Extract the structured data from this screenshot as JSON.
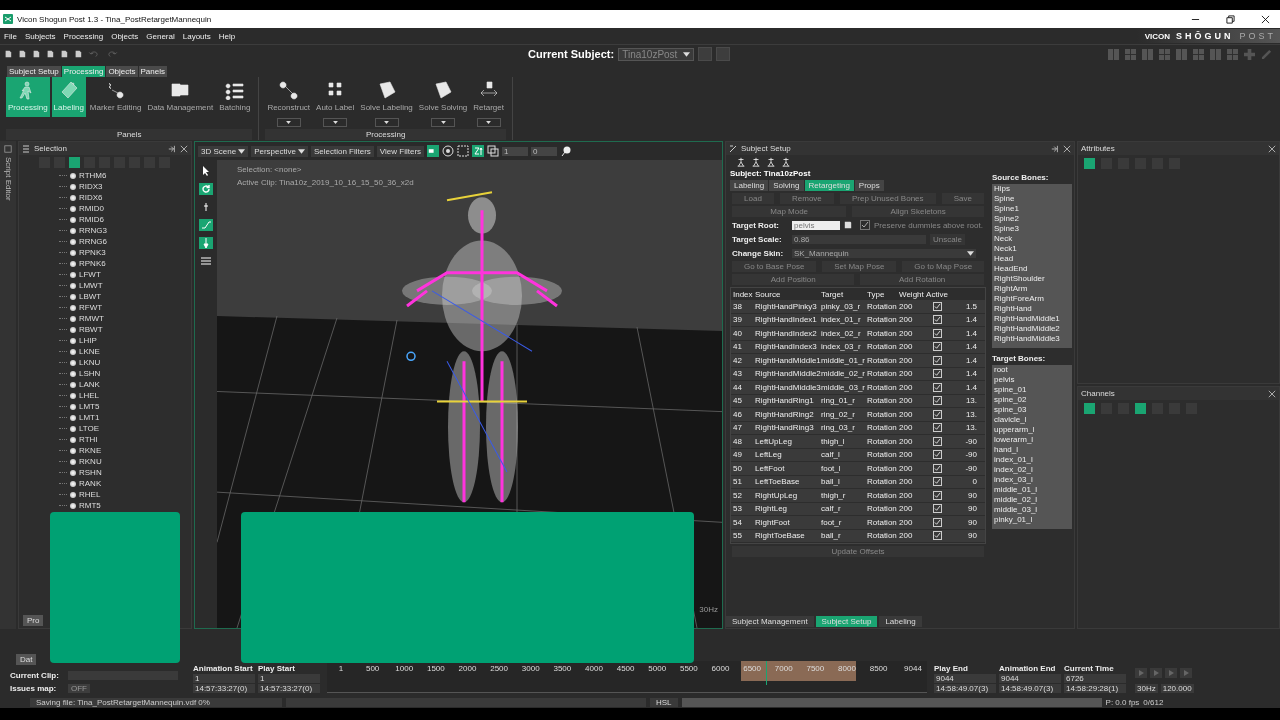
{
  "window": {
    "title": "Vicon Shogun Post 1.3  - Tina_PostRetargetMannequin"
  },
  "menu": [
    "File",
    "Subjects",
    "Processing",
    "Objects",
    "General",
    "Layouts",
    "Help"
  ],
  "brand": {
    "maker": "VICON",
    "product": "SHŌGUN",
    "edition": "POST"
  },
  "toolbar": {
    "current_subject_label": "Current Subject:",
    "current_subject": "Tina10zPost"
  },
  "ribbon": {
    "tabs": [
      {
        "label": "Subject Setup",
        "selected": false
      },
      {
        "label": "Processing",
        "selected": true
      },
      {
        "label": "Objects",
        "selected": false
      },
      {
        "label": "Panels",
        "selected": false
      }
    ],
    "groups": [
      {
        "label": "Panels",
        "buttons": [
          {
            "label": "Processing",
            "selected": true,
            "dropdown": false
          },
          {
            "label": "Labeling",
            "selected": true,
            "dropdown": false
          },
          {
            "label": "Marker Editing",
            "selected": false,
            "dropdown": false
          },
          {
            "label": "Data Management",
            "selected": false,
            "dropdown": false
          },
          {
            "label": "Batching",
            "selected": false,
            "dropdown": false
          }
        ]
      },
      {
        "label": "Processing",
        "buttons": [
          {
            "label": "Reconstruct",
            "selected": false,
            "dropdown": true
          },
          {
            "label": "Auto Label",
            "selected": false,
            "dropdown": true
          },
          {
            "label": "Solve Labeling",
            "selected": false,
            "dropdown": true
          },
          {
            "label": "Solve Solving",
            "selected": false,
            "dropdown": true
          },
          {
            "label": "Retarget",
            "selected": false,
            "dropdown": true
          }
        ]
      }
    ]
  },
  "side_tab": "Script Editor",
  "selection": {
    "title": "Selection",
    "items": [
      "RTHM6",
      "RIDX3",
      "RIDX6",
      "RMID0",
      "RMID6",
      "RRNG3",
      "RRNG6",
      "RPNK3",
      "RPNK6",
      "LFWT",
      "LMWT",
      "LBWT",
      "RFWT",
      "RMWT",
      "RBWT",
      "LHIP",
      "LKNE",
      "LKNU",
      "LSHN",
      "LANK",
      "LHEL",
      "LMT5",
      "LMT1",
      "LTOE",
      "RTHI",
      "RKNE",
      "RKNU",
      "RSHN",
      "RANK",
      "RHEL",
      "RMT5"
    ],
    "bottom_tab": "Pro"
  },
  "viewport": {
    "scene": "3D Scene",
    "view": "Perspective",
    "filters": [
      "Selection Filters",
      "View Filters"
    ],
    "fields": [
      "1",
      "0"
    ],
    "selection": "Selection: <none>",
    "active_clip": "Active Clip: Tina10z_2019_10_16_15_50_36_x2d",
    "rate": "30Hz"
  },
  "subject_setup": {
    "title": "Subject Setup",
    "subject": "Subject: Tina10zPost",
    "tabs": [
      {
        "label": "Labeling",
        "selected": false
      },
      {
        "label": "Solving",
        "selected": false
      },
      {
        "label": "Retargeting",
        "selected": true
      },
      {
        "label": "Props",
        "selected": false
      }
    ],
    "button_row_1": [
      {
        "label": "Load",
        "disabled": true
      },
      {
        "label": "Remove",
        "disabled": true
      },
      {
        "label": "Prep Unused Bones",
        "disabled": true
      },
      {
        "label": "Save",
        "disabled": true
      }
    ],
    "button_row_2": [
      {
        "label": "Map Mode",
        "disabled": true
      },
      {
        "label": "Align Skeletons",
        "disabled": true
      }
    ],
    "target_root": {
      "label": "Target Root:",
      "value": "pelvis"
    },
    "preserve_dummies": {
      "label": "Preserve dummies above root.",
      "checked": true
    },
    "target_scale": {
      "label": "Target Scale:",
      "value": "0.86",
      "button": "Unscale"
    },
    "change_skin": {
      "label": "Change Skin:",
      "value": "SK_Mannequin"
    },
    "button_row_3": [
      {
        "label": "Go to Base Pose",
        "disabled": true
      },
      {
        "label": "Set Map Pose",
        "disabled": true
      },
      {
        "label": "Go to Map Pose",
        "disabled": true
      }
    ],
    "button_row_4": [
      {
        "label": "Add Position",
        "disabled": true
      },
      {
        "label": "Add Rotation",
        "disabled": true
      }
    ],
    "table": {
      "columns": [
        "Index",
        "Source",
        "Target",
        "Type",
        "Weight",
        "Active"
      ],
      "rows": [
        {
          "index": "38",
          "source": "RightHandPinky3",
          "target": "pinky_03_r",
          "type": "Rotation",
          "weight": "200",
          "active": true,
          "column_7": "1.5"
        },
        {
          "index": "39",
          "source": "RightHandIndex1",
          "target": "index_01_r",
          "type": "Rotation",
          "weight": "200",
          "active": true,
          "column_7": "1.4"
        },
        {
          "index": "40",
          "source": "RightHandIndex2",
          "target": "index_02_r",
          "type": "Rotation",
          "weight": "200",
          "active": true,
          "column_7": "1.4"
        },
        {
          "index": "41",
          "source": "RightHandIndex3",
          "target": "index_03_r",
          "type": "Rotation",
          "weight": "200",
          "active": true,
          "column_7": "1.4"
        },
        {
          "index": "42",
          "source": "RightHandMiddle1",
          "target": "middle_01_r",
          "type": "Rotation",
          "weight": "200",
          "active": true,
          "column_7": "1.4"
        },
        {
          "index": "43",
          "source": "RightHandMiddle2",
          "target": "middle_02_r",
          "type": "Rotation",
          "weight": "200",
          "active": true,
          "column_7": "1.4"
        },
        {
          "index": "44",
          "source": "RightHandMiddle3",
          "target": "middle_03_r",
          "type": "Rotation",
          "weight": "200",
          "active": true,
          "column_7": "1.4"
        },
        {
          "index": "45",
          "source": "RightHandRing1",
          "target": "ring_01_r",
          "type": "Rotation",
          "weight": "200",
          "active": true,
          "column_7": "13."
        },
        {
          "index": "46",
          "source": "RightHandRing2",
          "target": "ring_02_r",
          "type": "Rotation",
          "weight": "200",
          "active": true,
          "column_7": "13."
        },
        {
          "index": "47",
          "source": "RightHandRing3",
          "target": "ring_03_r",
          "type": "Rotation",
          "weight": "200",
          "active": true,
          "column_7": "13."
        },
        {
          "index": "48",
          "source": "LeftUpLeg",
          "target": "thigh_l",
          "type": "Rotation",
          "weight": "200",
          "active": true,
          "column_7": "-90"
        },
        {
          "index": "49",
          "source": "LeftLeg",
          "target": "calf_l",
          "type": "Rotation",
          "weight": "200",
          "active": true,
          "column_7": "-90"
        },
        {
          "index": "50",
          "source": "LeftFoot",
          "target": "foot_l",
          "type": "Rotation",
          "weight": "200",
          "active": true,
          "column_7": "-90"
        },
        {
          "index": "51",
          "source": "LeftToeBase",
          "target": "ball_l",
          "type": "Rotation",
          "weight": "200",
          "active": true,
          "column_7": "0"
        },
        {
          "index": "52",
          "source": "RightUpLeg",
          "target": "thigh_r",
          "type": "Rotation",
          "weight": "200",
          "active": true,
          "column_7": "90"
        },
        {
          "index": "53",
          "source": "RightLeg",
          "target": "calf_r",
          "type": "Rotation",
          "weight": "200",
          "active": true,
          "column_7": "90"
        },
        {
          "index": "54",
          "source": "RightFoot",
          "target": "foot_r",
          "type": "Rotation",
          "weight": "200",
          "active": true,
          "column_7": "90"
        },
        {
          "index": "55",
          "source": "RightToeBase",
          "target": "ball_r",
          "type": "Rotation",
          "weight": "200",
          "active": true,
          "column_7": "90"
        }
      ]
    },
    "update_button": {
      "label": "Update Offsets",
      "disabled": true
    },
    "source_bones": {
      "label": "Source Bones:",
      "items": [
        "Hips",
        "Spine",
        "Spine1",
        "Spine2",
        "Spine3",
        "Neck",
        "Neck1",
        "Head",
        "HeadEnd",
        "RightShoulder",
        "RightArm",
        "RightForeArm",
        "RightHand",
        "RightHandMiddle1",
        "RightHandMiddle2",
        "RightHandMiddle3"
      ]
    },
    "target_bones": {
      "label": "Target Bones:",
      "items": [
        "root",
        "pelvis",
        "spine_01",
        "spine_02",
        "spine_03",
        "clavicle_l",
        "upperarm_l",
        "lowerarm_l",
        "hand_l",
        "index_01_l",
        "index_02_l",
        "index_03_l",
        "middle_01_l",
        "middle_02_l",
        "middle_03_l",
        "pinky_01_l"
      ]
    }
  },
  "bottom_tabs": [
    {
      "label": "Subject Management",
      "selected": false
    },
    {
      "label": "Subject Setup",
      "selected": true
    },
    {
      "label": "Labeling",
      "selected": false
    }
  ],
  "attributes": {
    "title": "Attributes"
  },
  "channels": {
    "title": "Channels"
  },
  "timeline": {
    "left_tab": "Dat",
    "current_clip_label": "Current Clip:",
    "issues_label": "Issues map:",
    "issues_value": "OFF",
    "animation_start": {
      "label": "Animation Start",
      "frame": "1",
      "time": "14:57:33:27(0)"
    },
    "play_start": {
      "label": "Play Start",
      "frame": "1",
      "time": "14:57:33:27(0)"
    },
    "ticks": [
      "1",
      "500",
      "1000",
      "1500",
      "2000",
      "2500",
      "3000",
      "3500",
      "4000",
      "4500",
      "5000",
      "5500",
      "6000",
      "6500",
      "7000",
      "7500",
      "8000",
      "8500",
      "9044"
    ],
    "play_end": {
      "label": "Play End",
      "frame": "9044",
      "time": "14:58:49.07(3)"
    },
    "animation_end": {
      "label": "Animation End",
      "frame": "9044",
      "time": "14:58:49.07(3)"
    },
    "current_time": {
      "label": "Current Time",
      "frame": "6726",
      "time": "14:58:29:28(1)"
    },
    "rate": "30Hz",
    "speed": "120.000"
  },
  "status_bar": {
    "message": "Saving file: Tina_PostRetargetMannequin.vdf 0%",
    "color_mode": "HSL",
    "fps": "P: 0.0 fps",
    "count": "0/612"
  }
}
